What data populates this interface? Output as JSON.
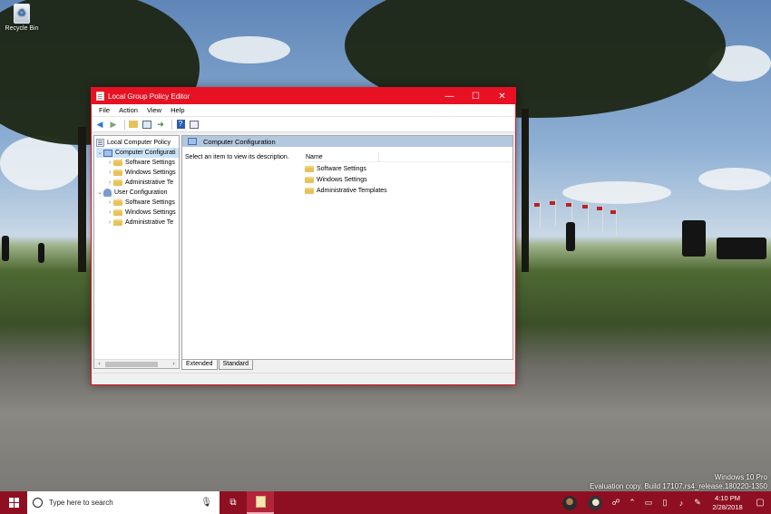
{
  "desktop": {
    "recycle_bin_label": "Recycle Bin",
    "watermark_line1": "Windows 10 Pro",
    "watermark_line2": "Evaluation copy. Build 17107.rs4_release.180220-1350"
  },
  "window": {
    "title": "Local Group Policy Editor",
    "controls": {
      "minimize": "—",
      "maximize": "☐",
      "close": "✕"
    },
    "accent_color": "#e81123",
    "menu": [
      "File",
      "Action",
      "View",
      "Help"
    ],
    "toolbar_icons": [
      "back-arrow-icon",
      "forward-arrow-icon",
      "up-folder-icon",
      "show-hide-tree-icon",
      "export-list-icon",
      "help-icon",
      "properties-icon"
    ]
  },
  "tree": {
    "root": "Local Computer Policy",
    "computer_config": "Computer Configurati",
    "computer_children": [
      "Software Settings",
      "Windows Settings",
      "Administrative Te"
    ],
    "user_config": "User Configuration",
    "user_children": [
      "Software Settings",
      "Windows Settings",
      "Administrative Te"
    ]
  },
  "detail": {
    "header": "Computer Configuration",
    "description": "Select an item to view its description.",
    "column_name": "Name",
    "items": [
      "Software Settings",
      "Windows Settings",
      "Administrative Templates"
    ]
  },
  "tabs": [
    "Extended",
    "Standard"
  ],
  "taskbar": {
    "search_placeholder": "Type here to search",
    "time": "4:10 PM",
    "date": "2/28/2018",
    "color": "#8e0f21"
  }
}
